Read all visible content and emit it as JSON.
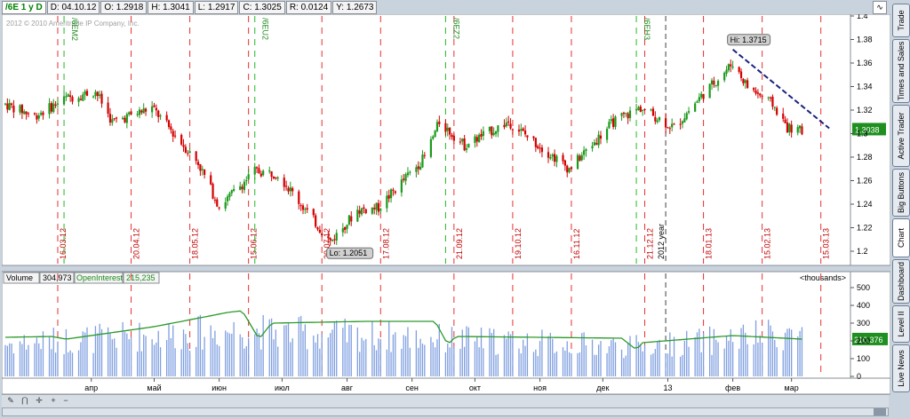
{
  "header": {
    "symbol": "/6E 1 y D",
    "date": "D: 04.10.12",
    "open": "O: 1.2918",
    "high": "H: 1.3041",
    "low": "L: 1.2917",
    "close": "C: 1.3025",
    "range": "R: 0.0124",
    "y": "Y: 1.2673",
    "copyright": "2012 © 2010 Ameritrade IP Company, Inc.",
    "style_icon": "wave-icon"
  },
  "volume_header": {
    "volume_label": "Volume",
    "volume_value": "304,973",
    "oi_label": "OpenInterest",
    "oi_value": "215,235",
    "units": "<thousands>"
  },
  "sidebar": {
    "tabs": [
      "Trade",
      "Times and Sales",
      "Active Trader",
      "Big Buttons",
      "Chart",
      "Dashboard",
      "Level II",
      "Live News"
    ],
    "active": "Chart"
  },
  "colors": {
    "up": "#1c9a1c",
    "down": "#d40000",
    "volume": "#7f9fe0",
    "open_interest": "#2a9a2a",
    "trendline": "#1a237e",
    "expiry_line": "#22b822",
    "event_line": "#e83030",
    "year_line": "#606060"
  },
  "chart_data": [
    {
      "type": "candlestick",
      "price_axis": {
        "min": 1.2,
        "max": 1.4,
        "ticks": [
          "1.2",
          "1.22",
          "1.24",
          "1.26",
          "1.28",
          "1.3",
          "1.32",
          "1.34",
          "1.36",
          "1.38",
          "1.4"
        ]
      },
      "months": [
        "апр",
        "май",
        "июн",
        "июл",
        "авг",
        "сен",
        "окт",
        "ноя",
        "дек",
        "13",
        "фев",
        "мар"
      ],
      "anchors": [
        {
          "date": "2012-02-20",
          "price": 1.325
        },
        {
          "date": "2012-03-05",
          "price": 1.315
        },
        {
          "date": "2012-03-20",
          "price": 1.33
        },
        {
          "date": "2012-04-03",
          "price": 1.336
        },
        {
          "date": "2012-04-11",
          "price": 1.31
        },
        {
          "date": "2012-04-30",
          "price": 1.322
        },
        {
          "date": "2012-05-08",
          "price": 1.305
        },
        {
          "date": "2012-05-22",
          "price": 1.275
        },
        {
          "date": "2012-06-01",
          "price": 1.238
        },
        {
          "date": "2012-06-18",
          "price": 1.268
        },
        {
          "date": "2012-06-29",
          "price": 1.266
        },
        {
          "date": "2012-07-10",
          "price": 1.24
        },
        {
          "date": "2012-07-24",
          "price": 1.208
        },
        {
          "date": "2012-08-06",
          "price": 1.235
        },
        {
          "date": "2012-08-16",
          "price": 1.237
        },
        {
          "date": "2012-09-07",
          "price": 1.28
        },
        {
          "date": "2012-09-14",
          "price": 1.31
        },
        {
          "date": "2012-09-26",
          "price": 1.29
        },
        {
          "date": "2012-10-17",
          "price": 1.31
        },
        {
          "date": "2012-11-15",
          "price": 1.27
        },
        {
          "date": "2012-12-06",
          "price": 1.31
        },
        {
          "date": "2012-12-19",
          "price": 1.322
        },
        {
          "date": "2013-01-04",
          "price": 1.305
        },
        {
          "date": "2013-01-17",
          "price": 1.332
        },
        {
          "date": "2013-02-01",
          "price": 1.36
        },
        {
          "date": "2013-02-08",
          "price": 1.34
        },
        {
          "date": "2013-02-20",
          "price": 1.325
        },
        {
          "date": "2013-02-27",
          "price": 1.305
        },
        {
          "date": "2013-03-06",
          "price": 1.302
        }
      ],
      "last_price": "1.3038",
      "high_label": "Hi: 1.3715",
      "low_label": "Lo: 1.2051",
      "high_point": {
        "date": "2013-02-01",
        "price": 1.3715
      },
      "low_point": {
        "date": "2012-07-24",
        "price": 1.2051
      },
      "trendline": [
        {
          "date": "2013-02-01",
          "price": 1.3715
        },
        {
          "date": "2013-03-19",
          "price": 1.3045
        }
      ],
      "expiry_lines": [
        {
          "date": "2012-03-19",
          "label": "/6EM2"
        },
        {
          "date": "2012-06-18",
          "label": "/6EU2"
        },
        {
          "date": "2012-09-17",
          "label": "/6EZ2"
        },
        {
          "date": "2012-12-17",
          "label": "/6EH3"
        }
      ],
      "event_lines": [
        {
          "date": "2012-03-16",
          "label": "16.03.12"
        },
        {
          "date": "2012-04-20",
          "label": "20.04.12"
        },
        {
          "date": "2012-05-18",
          "label": "18.05.12"
        },
        {
          "date": "2012-06-15",
          "label": "15.06.12"
        },
        {
          "date": "2012-07-20",
          "label": "20.07.12"
        },
        {
          "date": "2012-08-17",
          "label": "17.08.12"
        },
        {
          "date": "2012-09-21",
          "label": "21.09.12"
        },
        {
          "date": "2012-10-19",
          "label": "19.10.12"
        },
        {
          "date": "2012-11-16",
          "label": "16.11.12"
        },
        {
          "date": "2012-12-21",
          "label": "21.12.12"
        },
        {
          "date": "2013-01-18",
          "label": "18.01.13"
        },
        {
          "date": "2013-02-15",
          "label": "15.02.13"
        },
        {
          "date": "2013-03-15",
          "label": "15.03.13"
        }
      ],
      "year_line": {
        "date": "2012-12-31",
        "label": "2012 year"
      }
    },
    {
      "type": "bar+line",
      "ylim": [
        0,
        500
      ],
      "ticks": [
        "0",
        "100",
        "200",
        "300",
        "400",
        "500"
      ],
      "open_interest_last": "210.376",
      "open_interest_anchors": [
        {
          "date": "2012-02-20",
          "value": 220
        },
        {
          "date": "2012-03-13",
          "value": 225
        },
        {
          "date": "2012-03-20",
          "value": 210
        },
        {
          "date": "2012-05-01",
          "value": 280
        },
        {
          "date": "2012-06-05",
          "value": 360
        },
        {
          "date": "2012-06-12",
          "value": 370
        },
        {
          "date": "2012-06-20",
          "value": 210
        },
        {
          "date": "2012-06-26",
          "value": 300
        },
        {
          "date": "2012-08-10",
          "value": 310
        },
        {
          "date": "2012-09-12",
          "value": 310
        },
        {
          "date": "2012-09-18",
          "value": 180
        },
        {
          "date": "2012-09-22",
          "value": 225
        },
        {
          "date": "2012-12-10",
          "value": 215
        },
        {
          "date": "2012-12-17",
          "value": 150
        },
        {
          "date": "2012-12-20",
          "value": 190
        },
        {
          "date": "2013-02-01",
          "value": 230
        },
        {
          "date": "2013-03-06",
          "value": 210
        }
      ],
      "volume_profile": [
        {
          "date": "2012-02-20",
          "value": 200
        },
        {
          "date": "2012-06-10",
          "value": 280
        },
        {
          "date": "2012-09-14",
          "value": 230
        },
        {
          "date": "2012-12-20",
          "value": 180
        },
        {
          "date": "2013-03-06",
          "value": 270
        }
      ]
    }
  ]
}
